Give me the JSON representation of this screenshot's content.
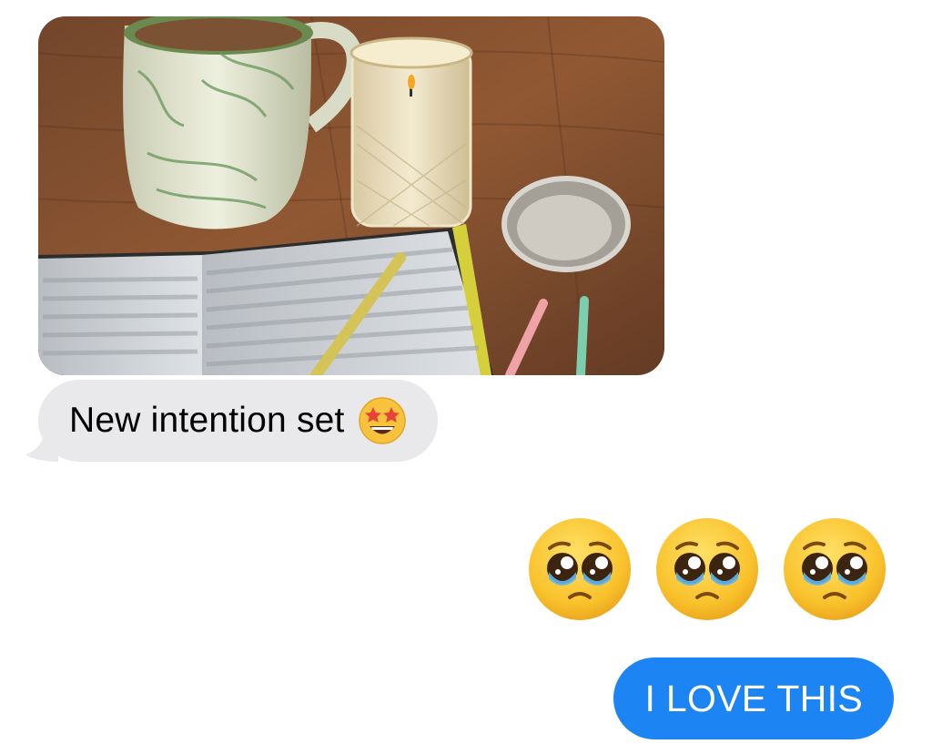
{
  "thread": {
    "received": {
      "photo_description_icon": "photo-attachment",
      "text": "New intention set",
      "emoji": "star-struck"
    },
    "sent_emoji": {
      "emojis": [
        "pleading-face",
        "pleading-face",
        "pleading-face"
      ]
    },
    "sent": {
      "text": "I LOVE THIS"
    }
  },
  "colors": {
    "received_bubble": "#e9e9eb",
    "sent_bubble": "#1d84f3",
    "background": "#ffffff"
  }
}
